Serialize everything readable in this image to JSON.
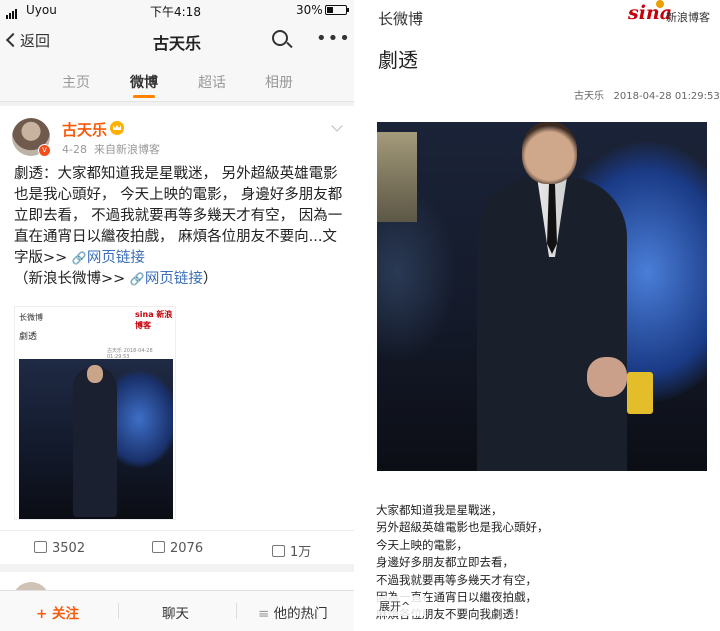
{
  "status_bar": {
    "carrier": "Uyou",
    "time": "下午4:18",
    "battery": "30%"
  },
  "nav": {
    "back_label": "返回",
    "title": "古天乐"
  },
  "tabs": [
    {
      "label": "主页",
      "active": false
    },
    {
      "label": "微博",
      "active": true
    },
    {
      "label": "超话",
      "active": false
    },
    {
      "label": "相册",
      "active": false
    }
  ],
  "accent_color": "#ff8200",
  "post": {
    "author": "古天乐",
    "date": "4-28",
    "source": "来自新浪博客",
    "text_main": "劇透：大家都知道我是星戰迷， 另外超級英雄電影也是我心頭好， 今天上映的電影， 身邊好多朋友都立即去看， 不過我就要再等多幾天才有空， 因為一直在通宵日以繼夜拍戲， 麻煩各位朋友不要向...文字版>> ",
    "link1": "网页链接",
    "text_mid": "（新浪长微博>> ",
    "link2": "网页链接",
    "text_end": "）",
    "thumb": {
      "site": "长微博",
      "logo": "sina 新浪博客",
      "title": "劇透",
      "byline": "古天乐  2018-04-28 01:29:53"
    },
    "reposts": "3502",
    "comments": "2076",
    "likes": "1万"
  },
  "bottom_bar": {
    "follow": "+ 关注",
    "chat": "聊天",
    "hot": "他的热门"
  },
  "blog": {
    "site": "长微博",
    "logo": "sina",
    "logo_sub": "新浪博客",
    "title": "劇透",
    "author": "古天乐",
    "datetime": "2018-04-28 01:29:53",
    "lines": [
      "大家都知道我是星戰迷，",
      "另外超級英雄電影也是我心頭好，",
      "今天上映的電影，",
      "身邊好多朋友都立即去看，",
      "不過我就要再等多幾天才有空，",
      "因為一直在通宵日以繼夜拍戲，",
      "麻煩各位朋友不要向我劇透！"
    ],
    "expand_label": "展开"
  }
}
